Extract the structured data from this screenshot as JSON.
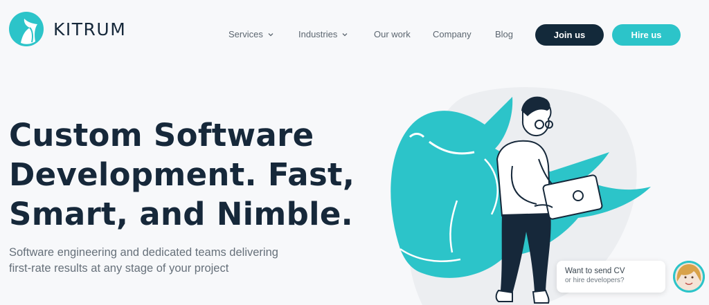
{
  "brand": {
    "name": "KITRUM"
  },
  "nav": {
    "items": [
      {
        "label": "Services",
        "has_dropdown": true
      },
      {
        "label": "Industries",
        "has_dropdown": true
      },
      {
        "label": "Our work",
        "has_dropdown": false
      },
      {
        "label": "Company",
        "has_dropdown": false
      },
      {
        "label": "Blog",
        "has_dropdown": false
      }
    ],
    "join_label": "Join us",
    "hire_label": "Hire us"
  },
  "hero": {
    "title_line1": "Custom Software",
    "title_line2": "Development. Fast,",
    "title_line3": "Smart, and Nimble.",
    "subtitle": "Software engineering and dedicated teams delivering first-rate results at any stage of your project"
  },
  "chat": {
    "line1": "Want to send CV",
    "line2": "or hire developers?"
  },
  "colors": {
    "accent": "#2cc4c9",
    "dark": "#13293a",
    "background": "#f7f8fa"
  },
  "icons": [
    "kitrum-logo-icon",
    "chevron-down-icon",
    "whale-illustration",
    "developer-illustration",
    "support-avatar"
  ]
}
